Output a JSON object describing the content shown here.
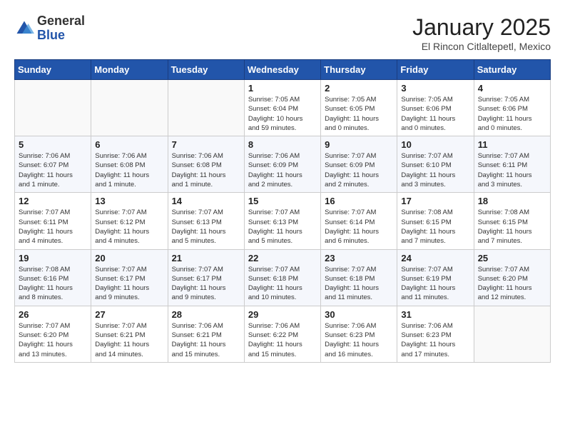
{
  "header": {
    "logo_general": "General",
    "logo_blue": "Blue",
    "title": "January 2025",
    "subtitle": "El Rincon Citlaltepetl, Mexico"
  },
  "days_of_week": [
    "Sunday",
    "Monday",
    "Tuesday",
    "Wednesday",
    "Thursday",
    "Friday",
    "Saturday"
  ],
  "weeks": [
    [
      {
        "day": "",
        "info": ""
      },
      {
        "day": "",
        "info": ""
      },
      {
        "day": "",
        "info": ""
      },
      {
        "day": "1",
        "info": "Sunrise: 7:05 AM\nSunset: 6:04 PM\nDaylight: 10 hours\nand 59 minutes."
      },
      {
        "day": "2",
        "info": "Sunrise: 7:05 AM\nSunset: 6:05 PM\nDaylight: 11 hours\nand 0 minutes."
      },
      {
        "day": "3",
        "info": "Sunrise: 7:05 AM\nSunset: 6:06 PM\nDaylight: 11 hours\nand 0 minutes."
      },
      {
        "day": "4",
        "info": "Sunrise: 7:05 AM\nSunset: 6:06 PM\nDaylight: 11 hours\nand 0 minutes."
      }
    ],
    [
      {
        "day": "5",
        "info": "Sunrise: 7:06 AM\nSunset: 6:07 PM\nDaylight: 11 hours\nand 1 minute."
      },
      {
        "day": "6",
        "info": "Sunrise: 7:06 AM\nSunset: 6:08 PM\nDaylight: 11 hours\nand 1 minute."
      },
      {
        "day": "7",
        "info": "Sunrise: 7:06 AM\nSunset: 6:08 PM\nDaylight: 11 hours\nand 1 minute."
      },
      {
        "day": "8",
        "info": "Sunrise: 7:06 AM\nSunset: 6:09 PM\nDaylight: 11 hours\nand 2 minutes."
      },
      {
        "day": "9",
        "info": "Sunrise: 7:07 AM\nSunset: 6:09 PM\nDaylight: 11 hours\nand 2 minutes."
      },
      {
        "day": "10",
        "info": "Sunrise: 7:07 AM\nSunset: 6:10 PM\nDaylight: 11 hours\nand 3 minutes."
      },
      {
        "day": "11",
        "info": "Sunrise: 7:07 AM\nSunset: 6:11 PM\nDaylight: 11 hours\nand 3 minutes."
      }
    ],
    [
      {
        "day": "12",
        "info": "Sunrise: 7:07 AM\nSunset: 6:11 PM\nDaylight: 11 hours\nand 4 minutes."
      },
      {
        "day": "13",
        "info": "Sunrise: 7:07 AM\nSunset: 6:12 PM\nDaylight: 11 hours\nand 4 minutes."
      },
      {
        "day": "14",
        "info": "Sunrise: 7:07 AM\nSunset: 6:13 PM\nDaylight: 11 hours\nand 5 minutes."
      },
      {
        "day": "15",
        "info": "Sunrise: 7:07 AM\nSunset: 6:13 PM\nDaylight: 11 hours\nand 5 minutes."
      },
      {
        "day": "16",
        "info": "Sunrise: 7:07 AM\nSunset: 6:14 PM\nDaylight: 11 hours\nand 6 minutes."
      },
      {
        "day": "17",
        "info": "Sunrise: 7:08 AM\nSunset: 6:15 PM\nDaylight: 11 hours\nand 7 minutes."
      },
      {
        "day": "18",
        "info": "Sunrise: 7:08 AM\nSunset: 6:15 PM\nDaylight: 11 hours\nand 7 minutes."
      }
    ],
    [
      {
        "day": "19",
        "info": "Sunrise: 7:08 AM\nSunset: 6:16 PM\nDaylight: 11 hours\nand 8 minutes."
      },
      {
        "day": "20",
        "info": "Sunrise: 7:07 AM\nSunset: 6:17 PM\nDaylight: 11 hours\nand 9 minutes."
      },
      {
        "day": "21",
        "info": "Sunrise: 7:07 AM\nSunset: 6:17 PM\nDaylight: 11 hours\nand 9 minutes."
      },
      {
        "day": "22",
        "info": "Sunrise: 7:07 AM\nSunset: 6:18 PM\nDaylight: 11 hours\nand 10 minutes."
      },
      {
        "day": "23",
        "info": "Sunrise: 7:07 AM\nSunset: 6:18 PM\nDaylight: 11 hours\nand 11 minutes."
      },
      {
        "day": "24",
        "info": "Sunrise: 7:07 AM\nSunset: 6:19 PM\nDaylight: 11 hours\nand 11 minutes."
      },
      {
        "day": "25",
        "info": "Sunrise: 7:07 AM\nSunset: 6:20 PM\nDaylight: 11 hours\nand 12 minutes."
      }
    ],
    [
      {
        "day": "26",
        "info": "Sunrise: 7:07 AM\nSunset: 6:20 PM\nDaylight: 11 hours\nand 13 minutes."
      },
      {
        "day": "27",
        "info": "Sunrise: 7:07 AM\nSunset: 6:21 PM\nDaylight: 11 hours\nand 14 minutes."
      },
      {
        "day": "28",
        "info": "Sunrise: 7:06 AM\nSunset: 6:21 PM\nDaylight: 11 hours\nand 15 minutes."
      },
      {
        "day": "29",
        "info": "Sunrise: 7:06 AM\nSunset: 6:22 PM\nDaylight: 11 hours\nand 15 minutes."
      },
      {
        "day": "30",
        "info": "Sunrise: 7:06 AM\nSunset: 6:23 PM\nDaylight: 11 hours\nand 16 minutes."
      },
      {
        "day": "31",
        "info": "Sunrise: 7:06 AM\nSunset: 6:23 PM\nDaylight: 11 hours\nand 17 minutes."
      },
      {
        "day": "",
        "info": ""
      }
    ]
  ]
}
